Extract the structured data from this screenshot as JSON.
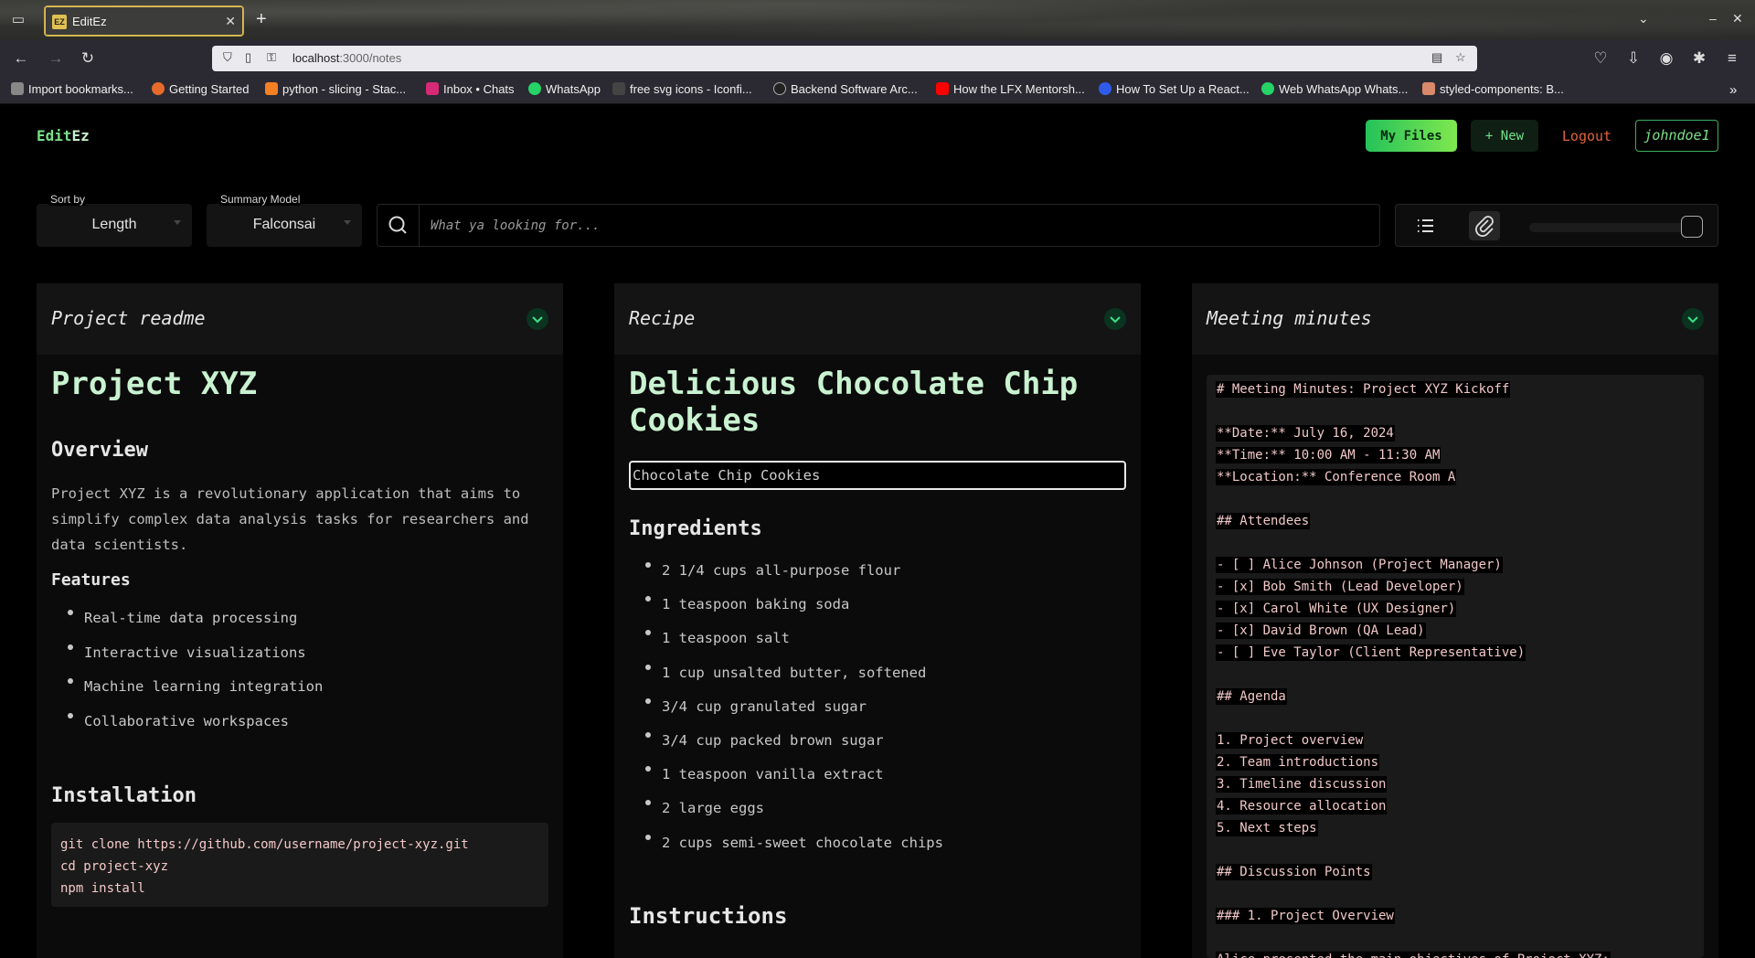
{
  "browser": {
    "tab_title": "EditEz",
    "favicon": "EZ",
    "url_host": "localhost",
    "url_rest": ":3000/notes",
    "bookmarks": [
      "Import bookmarks...",
      "Getting Started",
      "python - slicing - Stac...",
      "Inbox • Chats",
      "WhatsApp",
      "free svg icons - Iconfi...",
      "Backend Software Arc...",
      "How the LFX Mentorsh...",
      "How To Set Up a React...",
      "Web WhatsApp Whats...",
      "styled-components: B..."
    ]
  },
  "header": {
    "logo_part1": "Edit",
    "logo_part2": "Ez",
    "my_files": "My Files",
    "new": "+ New",
    "logout": "Logout",
    "username": "johndoe1"
  },
  "filters": {
    "sort_label": "Sort by",
    "sort_value": "Length",
    "model_label": "Summary Model",
    "model_value": "Falconsai",
    "search_placeholder": "What ya looking for..."
  },
  "cards": [
    {
      "title": "Project readme",
      "h1": "Project XYZ",
      "overview_h": "Overview",
      "overview_lines": [
        "Project XYZ is a revolutionary application that aims to",
        "simplify complex data analysis tasks for researchers and",
        "data scientists."
      ],
      "features_h": "Features",
      "features": [
        "Real-time data processing",
        "Interactive visualizations",
        "Machine learning integration",
        "Collaborative workspaces"
      ],
      "install_h": "Installation",
      "install_code": [
        "git clone https://github.com/username/project-xyz.git",
        "cd project-xyz",
        "npm install"
      ]
    },
    {
      "title": "Recipe",
      "h1_line1": "Delicious Chocolate Chip",
      "h1_line2": "Cookies",
      "input_value": "Chocolate Chip Cookies",
      "ingredients_h": "Ingredients",
      "ingredients": [
        "2 1/4 cups all-purpose flour",
        "1 teaspoon baking soda",
        "1 teaspoon salt",
        "1 cup unsalted butter, softened",
        "3/4 cup granulated sugar",
        "3/4 cup packed brown sugar",
        "1 teaspoon vanilla extract",
        "2 large eggs",
        "2 cups semi-sweet chocolate chips"
      ],
      "instructions_h": "Instructions"
    },
    {
      "title": "Meeting minutes",
      "lines": [
        "# Meeting Minutes: Project XYZ Kickoff",
        "",
        "**Date:** July 16, 2024",
        "**Time:** 10:00 AM - 11:30 AM",
        "**Location:** Conference Room A",
        "",
        "## Attendees",
        "",
        "- [ ] Alice Johnson (Project Manager)",
        "- [x] Bob Smith (Lead Developer)",
        "- [x] Carol White (UX Designer)",
        "- [x] David Brown (QA Lead)",
        "- [ ] Eve Taylor (Client Representative)",
        "",
        "## Agenda",
        "",
        "1. Project overview",
        "2. Team introductions",
        "3. Timeline discussion",
        "4. Resource allocation",
        "5. Next steps",
        "",
        "## Discussion Points",
        "",
        "### 1. Project Overview",
        "",
        "Alice presented the main objectives of Project XYZ:"
      ]
    }
  ],
  "colors": {
    "accent": "#7ae08a",
    "logout": "#e0623c",
    "code_text": "#f2c8c8"
  }
}
